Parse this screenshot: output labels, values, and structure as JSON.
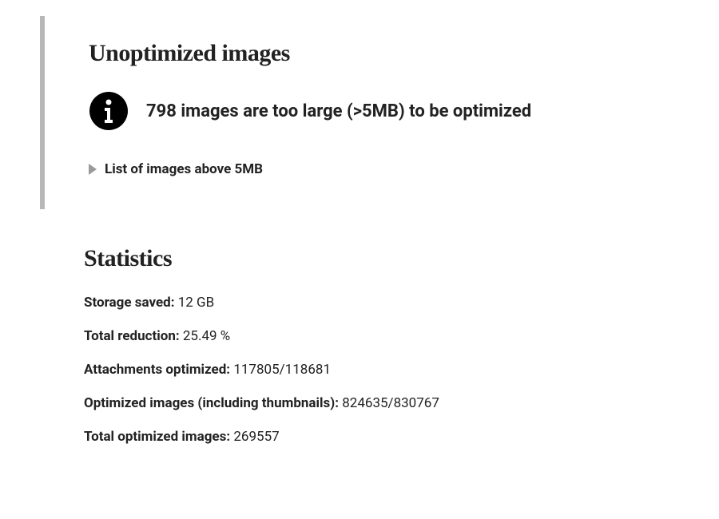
{
  "unoptimized": {
    "heading": "Unoptimized images",
    "info_message": "798 images are too large (>5MB) to be optimized",
    "expand_label": "List of images above 5MB"
  },
  "statistics": {
    "heading": "Statistics",
    "rows": [
      {
        "label": "Storage saved:",
        "value": "12 GB"
      },
      {
        "label": "Total reduction:",
        "value": "25.49 %"
      },
      {
        "label": "Attachments optimized:",
        "value": "117805/118681"
      },
      {
        "label": "Optimized images (including thumbnails):",
        "value": "824635/830767"
      },
      {
        "label": "Total optimized images:",
        "value": "269557"
      }
    ]
  }
}
